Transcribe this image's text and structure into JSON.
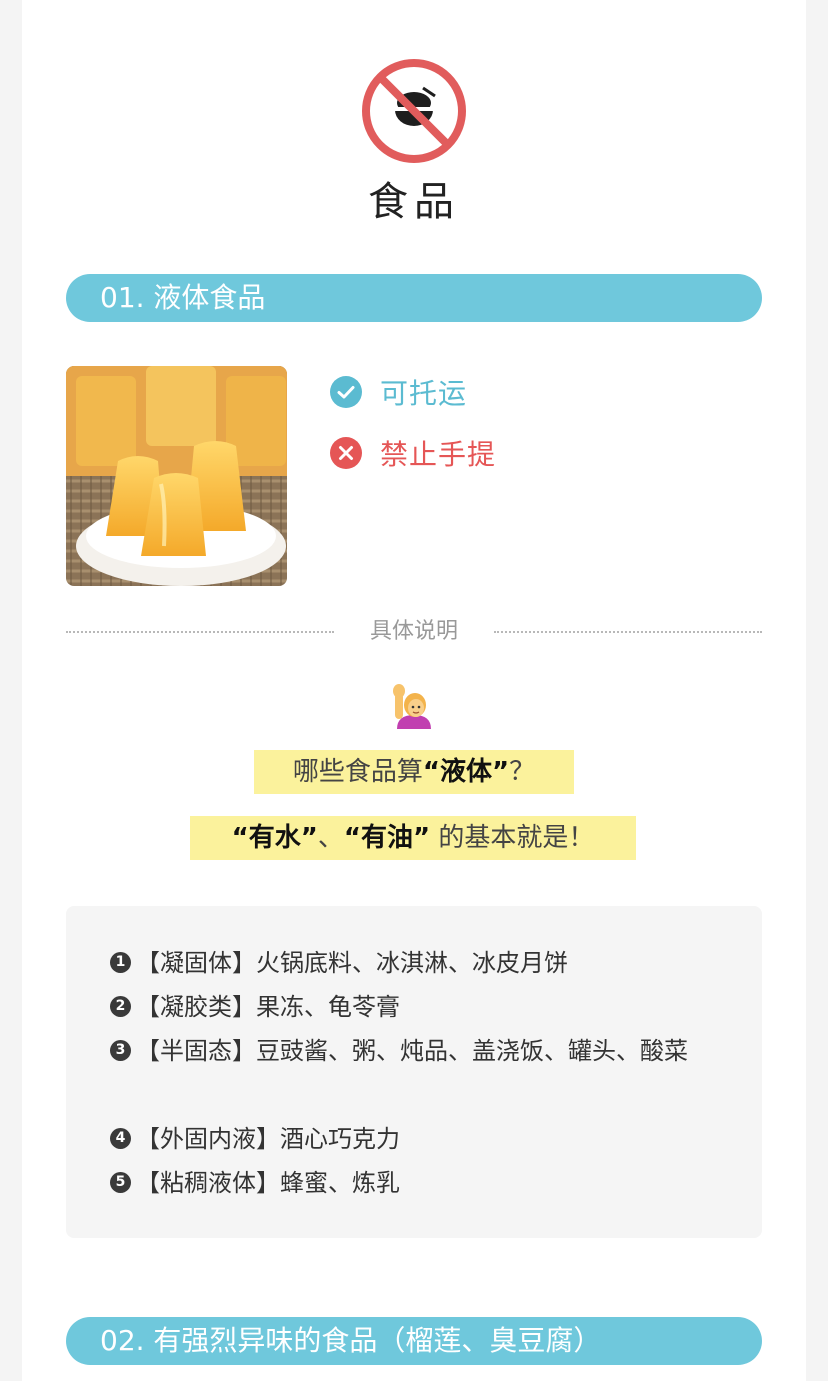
{
  "header": {
    "icon": "no-food-icon",
    "title": "食品"
  },
  "section1": {
    "banner": "01. 液体食品",
    "status": {
      "allowed_label": "可托运",
      "forbidden_label": "禁止手提"
    },
    "divider_label": "具体说明",
    "question": {
      "prefix": "哪些食品算",
      "bold": "“液体”",
      "suffix": "？"
    },
    "answer": {
      "bold1": "“有水”",
      "sep": "、",
      "bold2": "“有油”",
      "suffix": " 的基本就是！"
    },
    "list": [
      {
        "num": "1",
        "text": "【凝固体】火锅底料、冰淇淋、冰皮月饼"
      },
      {
        "num": "2",
        "text": "【凝胶类】果冻、龟苓膏"
      },
      {
        "num": "3",
        "text": "【半固态】豆豉酱、粥、炖品、盖浇饭、罐头、酸菜"
      },
      {
        "num": "4",
        "text": "【外固内液】酒心巧克力"
      },
      {
        "num": "5",
        "text": "【粘稠液体】蜂蜜、炼乳"
      }
    ]
  },
  "section2": {
    "banner": "02. 有强烈异味的食品（榴莲、臭豆腐）"
  },
  "colors": {
    "banner": "#6fc8dc",
    "allowed": "#5bbbd1",
    "forbidden": "#e55656",
    "highlight": "#fbf29c"
  }
}
